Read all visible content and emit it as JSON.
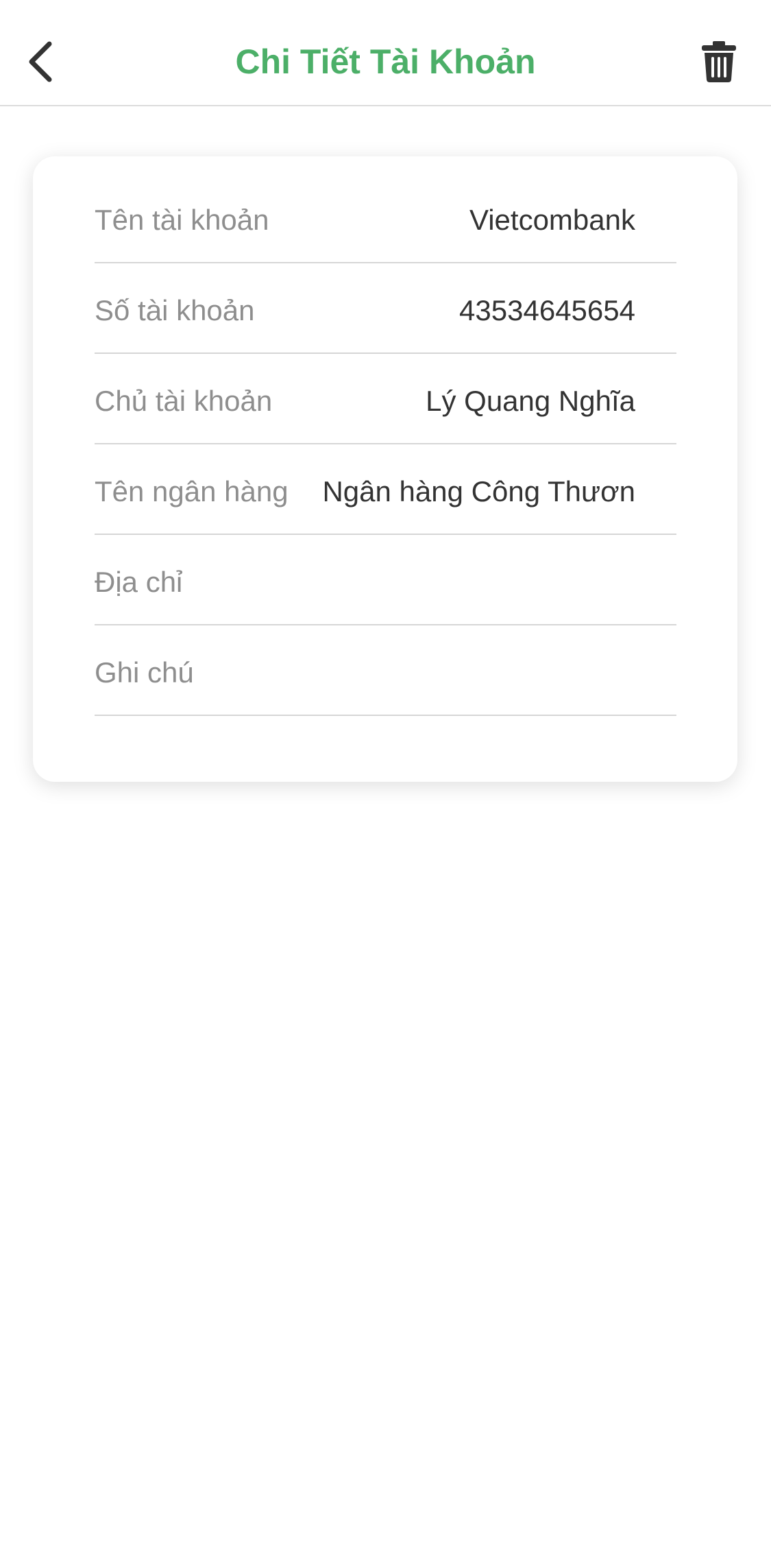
{
  "header": {
    "title": "Chi Tiết Tài Khoản",
    "back_icon": "chevron-left-icon",
    "trash_icon": "trash-icon"
  },
  "colors": {
    "accent": "#4caf68",
    "icon": "#333333",
    "label": "#8e8e8e",
    "value": "#333333",
    "divider": "#d6d6d6"
  },
  "details": {
    "rows": [
      {
        "label": "Tên tài khoản",
        "value": "Vietcombank"
      },
      {
        "label": "Số tài khoản",
        "value": "43534645654"
      },
      {
        "label": "Chủ tài khoản",
        "value": "Lý Quang Nghĩa"
      },
      {
        "label": "Tên ngân hàng",
        "value": "Ngân hàng Công Thươn"
      },
      {
        "label": "Địa chỉ",
        "value": ""
      },
      {
        "label": "Ghi chú",
        "value": ""
      }
    ]
  }
}
